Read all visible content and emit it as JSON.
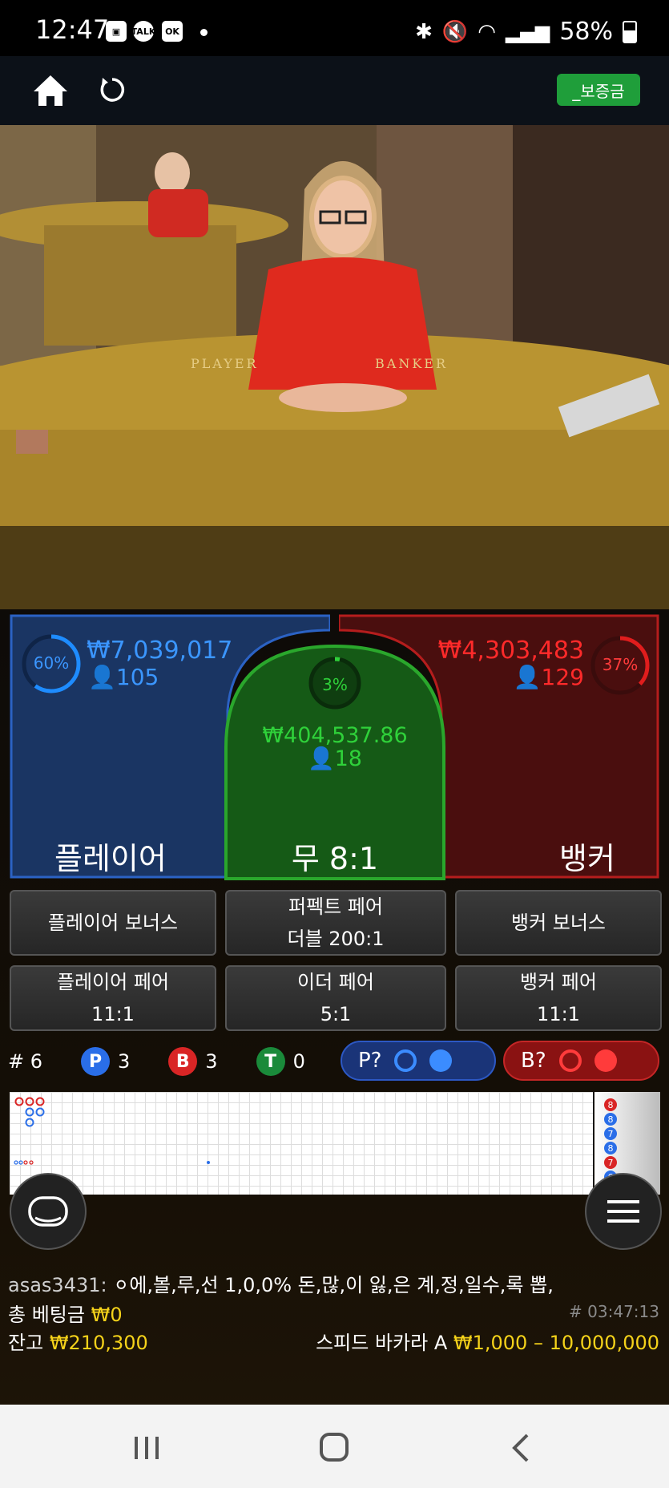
{
  "status_bar": {
    "time": "12:47",
    "battery": "58%",
    "notif_icons": [
      "gallery-icon",
      "talk-icon",
      "ok-icon"
    ]
  },
  "top_nav": {
    "deposit_label": "_보증금"
  },
  "video": {
    "table_player_text": "PLAYER",
    "table_banker_text": "BANKER"
  },
  "player": {
    "percent": "60%",
    "amount": "₩7,039,017",
    "count": "105",
    "label": "플레이어"
  },
  "tie": {
    "percent": "3%",
    "amount": "₩404,537.86",
    "count": "18",
    "label": "무 8:1"
  },
  "banker": {
    "percent": "37%",
    "amount": "₩4,303,483",
    "count": "129",
    "label": "뱅커"
  },
  "side_bets": {
    "player_bonus": "플레이어 보너스",
    "perfect_pair_1": "퍼펙트 페어",
    "perfect_pair_2": "더블 200:1",
    "banker_bonus": "뱅커 보너스",
    "player_pair_1": "플레이어 페어",
    "player_pair_2": "11:1",
    "either_pair_1": "이더 페어",
    "either_pair_2": "5:1",
    "banker_pair_1": "뱅커 페어",
    "banker_pair_2": "11:1"
  },
  "stats": {
    "round": "# 6",
    "p_label": "P",
    "p_count": "3",
    "b_label": "B",
    "b_count": "3",
    "t_label": "T",
    "t_count": "0",
    "p_predict": "P?",
    "b_predict": "B?"
  },
  "road_side": [
    "8",
    "8",
    "7",
    "8",
    "7",
    "6"
  ],
  "chat": {
    "user": "asas3431:",
    "message": "⚪에,볼,루,선 1,0,0% 돈,많,이 잃,은 계,정,일수,록 뽑,"
  },
  "bottom": {
    "total_bet_label": "총 베팅금",
    "total_bet_value": "₩0",
    "game_id": "# 03:47:13",
    "balance_label": "잔고",
    "balance_value": "₩210,300",
    "table_name": "스피드 바카라 A",
    "limits": "₩1,000 – 10,000,000"
  },
  "colors": {
    "player": "#1e6fd9",
    "banker": "#e01d1d",
    "tie": "#2fd13a",
    "gold": "#f5d21a"
  }
}
